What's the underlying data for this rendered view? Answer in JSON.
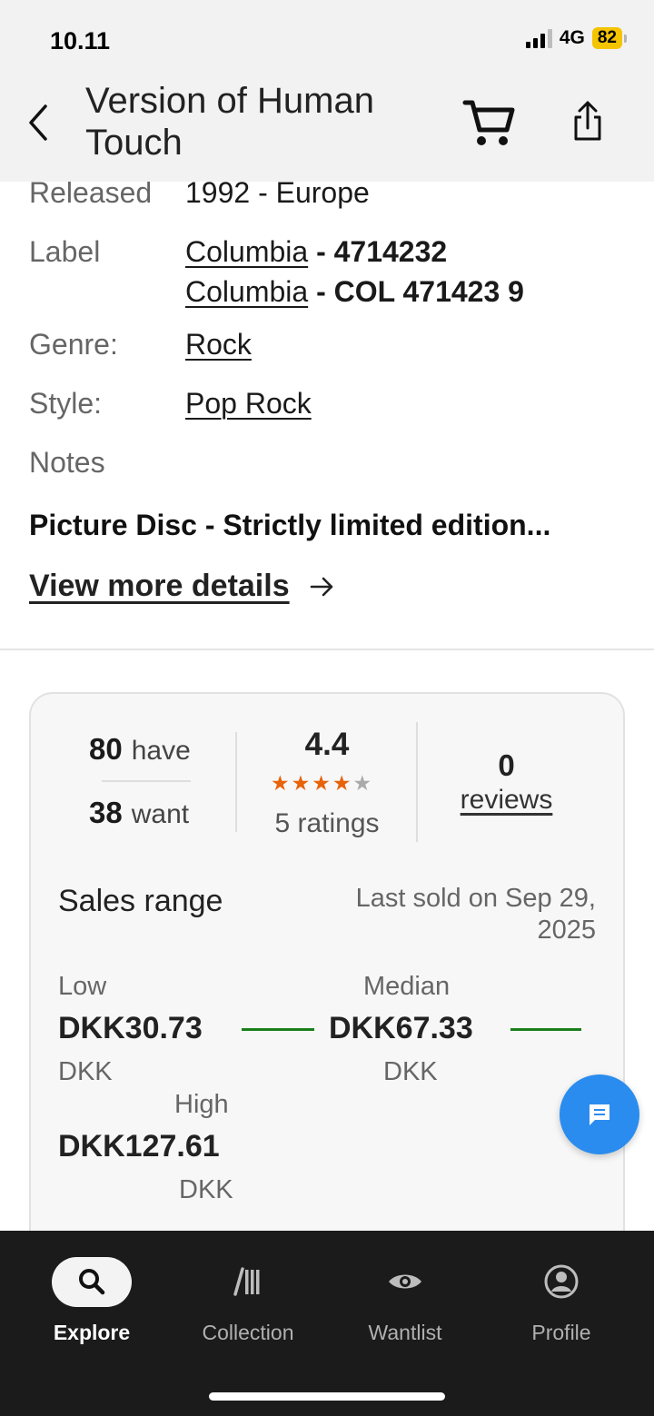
{
  "status_bar": {
    "time": "10.11",
    "network": "4G",
    "battery": "82"
  },
  "header": {
    "title": "Version of Human Touch"
  },
  "details": {
    "released_label": "Released",
    "released_value": "1992 - Europe",
    "label_label": "Label",
    "labels": [
      {
        "name": "Columbia",
        "catno": " - 4714232"
      },
      {
        "name": "Columbia",
        "catno": " - COL 471423 9"
      }
    ],
    "genre_label": "Genre:",
    "genre_value": "Rock",
    "style_label": "Style:",
    "style_value": "Pop Rock",
    "notes_label": "Notes",
    "notes_text": "Picture Disc - Strictly limited edition...",
    "view_more": "View more details"
  },
  "stats": {
    "have_count": "80",
    "have_word": "have",
    "want_count": "38",
    "want_word": "want",
    "rating": "4.4",
    "rating_stars": 4.4,
    "ratings_count": "5 ratings",
    "reviews_count": "0",
    "reviews_word": "reviews"
  },
  "sales": {
    "title": "Sales range",
    "last_sold": "Last sold on Sep 29, 2025",
    "low_label": "Low",
    "low_value": "DKK30.73",
    "low_currency": "DKK",
    "median_label": "Median",
    "median_value": "DKK67.33",
    "median_currency": "DKK",
    "high_label": "High",
    "high_value": "DKK127.61",
    "high_currency": "DKK"
  },
  "bottom_nav": [
    {
      "label": "Explore",
      "icon": "search-icon",
      "active": true
    },
    {
      "label": "Collection",
      "icon": "collection-icon",
      "active": false
    },
    {
      "label": "Wantlist",
      "icon": "eye-icon",
      "active": false
    },
    {
      "label": "Profile",
      "icon": "profile-icon",
      "active": false
    }
  ],
  "colors": {
    "accent_star": "#e8630a",
    "line_green": "#1a7f1a",
    "fab_blue": "#2a8cee",
    "nav_bg": "#1b1b1b"
  }
}
